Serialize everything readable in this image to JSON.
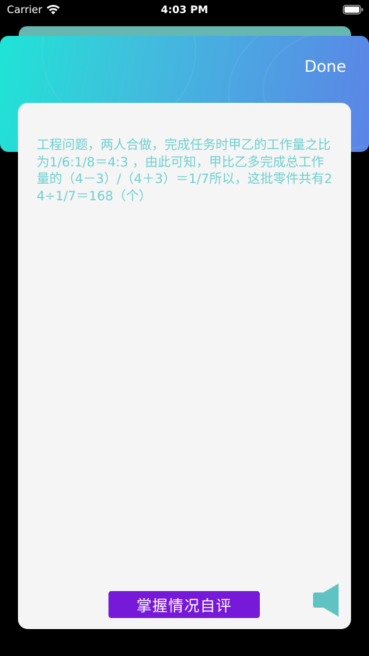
{
  "status_bar": {
    "carrier": "Carrier",
    "time": "4:03 PM",
    "icons": [
      "wifi-icon",
      "battery-icon"
    ]
  },
  "header": {
    "done_label": "Done",
    "gradient": [
      "#1fe4d6",
      "#5b84e6"
    ]
  },
  "content": {
    "explanation": "工程问题，两人合做，完成任务时甲乙的工作量之比为1/6:1/8＝4:3 ，由此可知，甲比乙多完成总工作量的（4－3）/（4＋3）＝1/7所以，这批零件共有24÷1/7＝168（个）",
    "text_color": "#6fcfcf"
  },
  "actions": {
    "self_eval_label": "掌握情况自评",
    "self_eval_color": "#7719d9",
    "speaker_icon": "speaker-icon",
    "speaker_color": "#5fc3c3"
  }
}
